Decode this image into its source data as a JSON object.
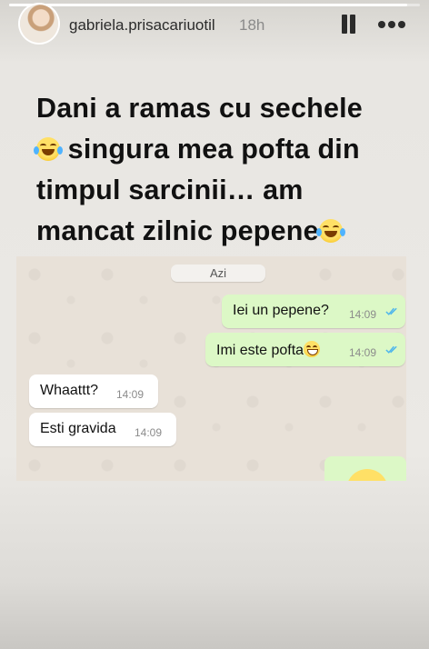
{
  "story": {
    "progress": 0.97,
    "username": "gabriela.prisacariuotil",
    "time_ago": "18h"
  },
  "caption": {
    "line1": "Dani a ramas cu sechele",
    "line2": " singura mea pofta din",
    "line3": "timpul sarcinii… am",
    "line4": "mancat zilnic pepene",
    "emoji": "face-with-tears-of-joy"
  },
  "chat": {
    "date_label": "Azi",
    "messages": [
      {
        "direction": "out",
        "text": "Iei un pepene?",
        "time": "14:09",
        "status": "read"
      },
      {
        "direction": "out",
        "text": "Imi este pofta",
        "emoji": "grinning-face",
        "time": "14:09",
        "status": "read"
      },
      {
        "direction": "in",
        "text": "Whaattt?",
        "time": "14:09"
      },
      {
        "direction": "in",
        "text": "Esti gravida",
        "time": "14:09"
      }
    ],
    "tick_color": "#4fb6ec",
    "outgoing_color": "#dcf8c6",
    "incoming_color": "#ffffff"
  }
}
